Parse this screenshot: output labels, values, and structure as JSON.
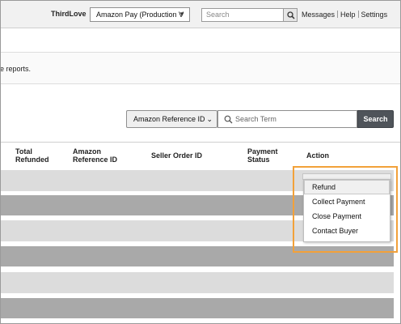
{
  "header": {
    "seller_name": "ThirdLove",
    "account_selector": "Amazon Pay (Production V",
    "search_placeholder": "Search",
    "links": [
      "Messages",
      "Help",
      "Settings"
    ]
  },
  "notice": {
    "text": "e reports."
  },
  "filters": {
    "search_type": "Amazon Reference ID",
    "search_placeholder": "Search Term",
    "search_button": "Search"
  },
  "table": {
    "columns": [
      {
        "label_line1": "Total",
        "label_line2": "Refunded"
      },
      {
        "label_line1": "Amazon",
        "label_line2": "Reference ID"
      },
      {
        "label_line1": "Seller Order ID",
        "label_line2": ""
      },
      {
        "label_line1": "Payment",
        "label_line2": "Status"
      },
      {
        "label_line1": "Action",
        "label_line2": ""
      }
    ]
  },
  "action_menu": {
    "items": [
      "Refund",
      "Collect Payment",
      "Close Payment",
      "Contact Buyer"
    ],
    "hovered": "Refund"
  },
  "colors": {
    "highlight": "#f2a13a",
    "search_button": "#4f545a"
  }
}
